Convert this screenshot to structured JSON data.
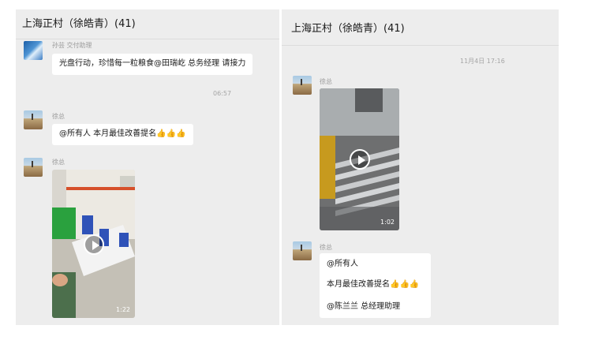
{
  "left_panel": {
    "title": "上海正村（徐皓青）(41)",
    "messages": [
      {
        "sender": "孙芸 交付助理",
        "text": "光盘行动，珍惜每一粒粮食@田瑞屹 总务经理 请接力"
      },
      {
        "time": "06:57"
      },
      {
        "sender": "徐总",
        "text": "@所有人 本月最佳改善提名",
        "thumbs": "👍👍👍"
      },
      {
        "sender": "徐总",
        "video_duration": "1:22"
      }
    ]
  },
  "right_panel": {
    "title": "上海正村（徐皓青）(41)",
    "messages": [
      {
        "time": "11月4日 17:16"
      },
      {
        "sender": "徐总",
        "video_duration": "1:02"
      },
      {
        "sender": "徐总",
        "lines": [
          "@所有人",
          "本月最佳改善提名",
          "@陈兰兰 总经理助理"
        ],
        "thumbs": "👍👍👍"
      }
    ]
  },
  "colors": {
    "panel_bg": "#ededed",
    "bubble_bg": "#ffffff",
    "thumb": "#f0b400"
  }
}
